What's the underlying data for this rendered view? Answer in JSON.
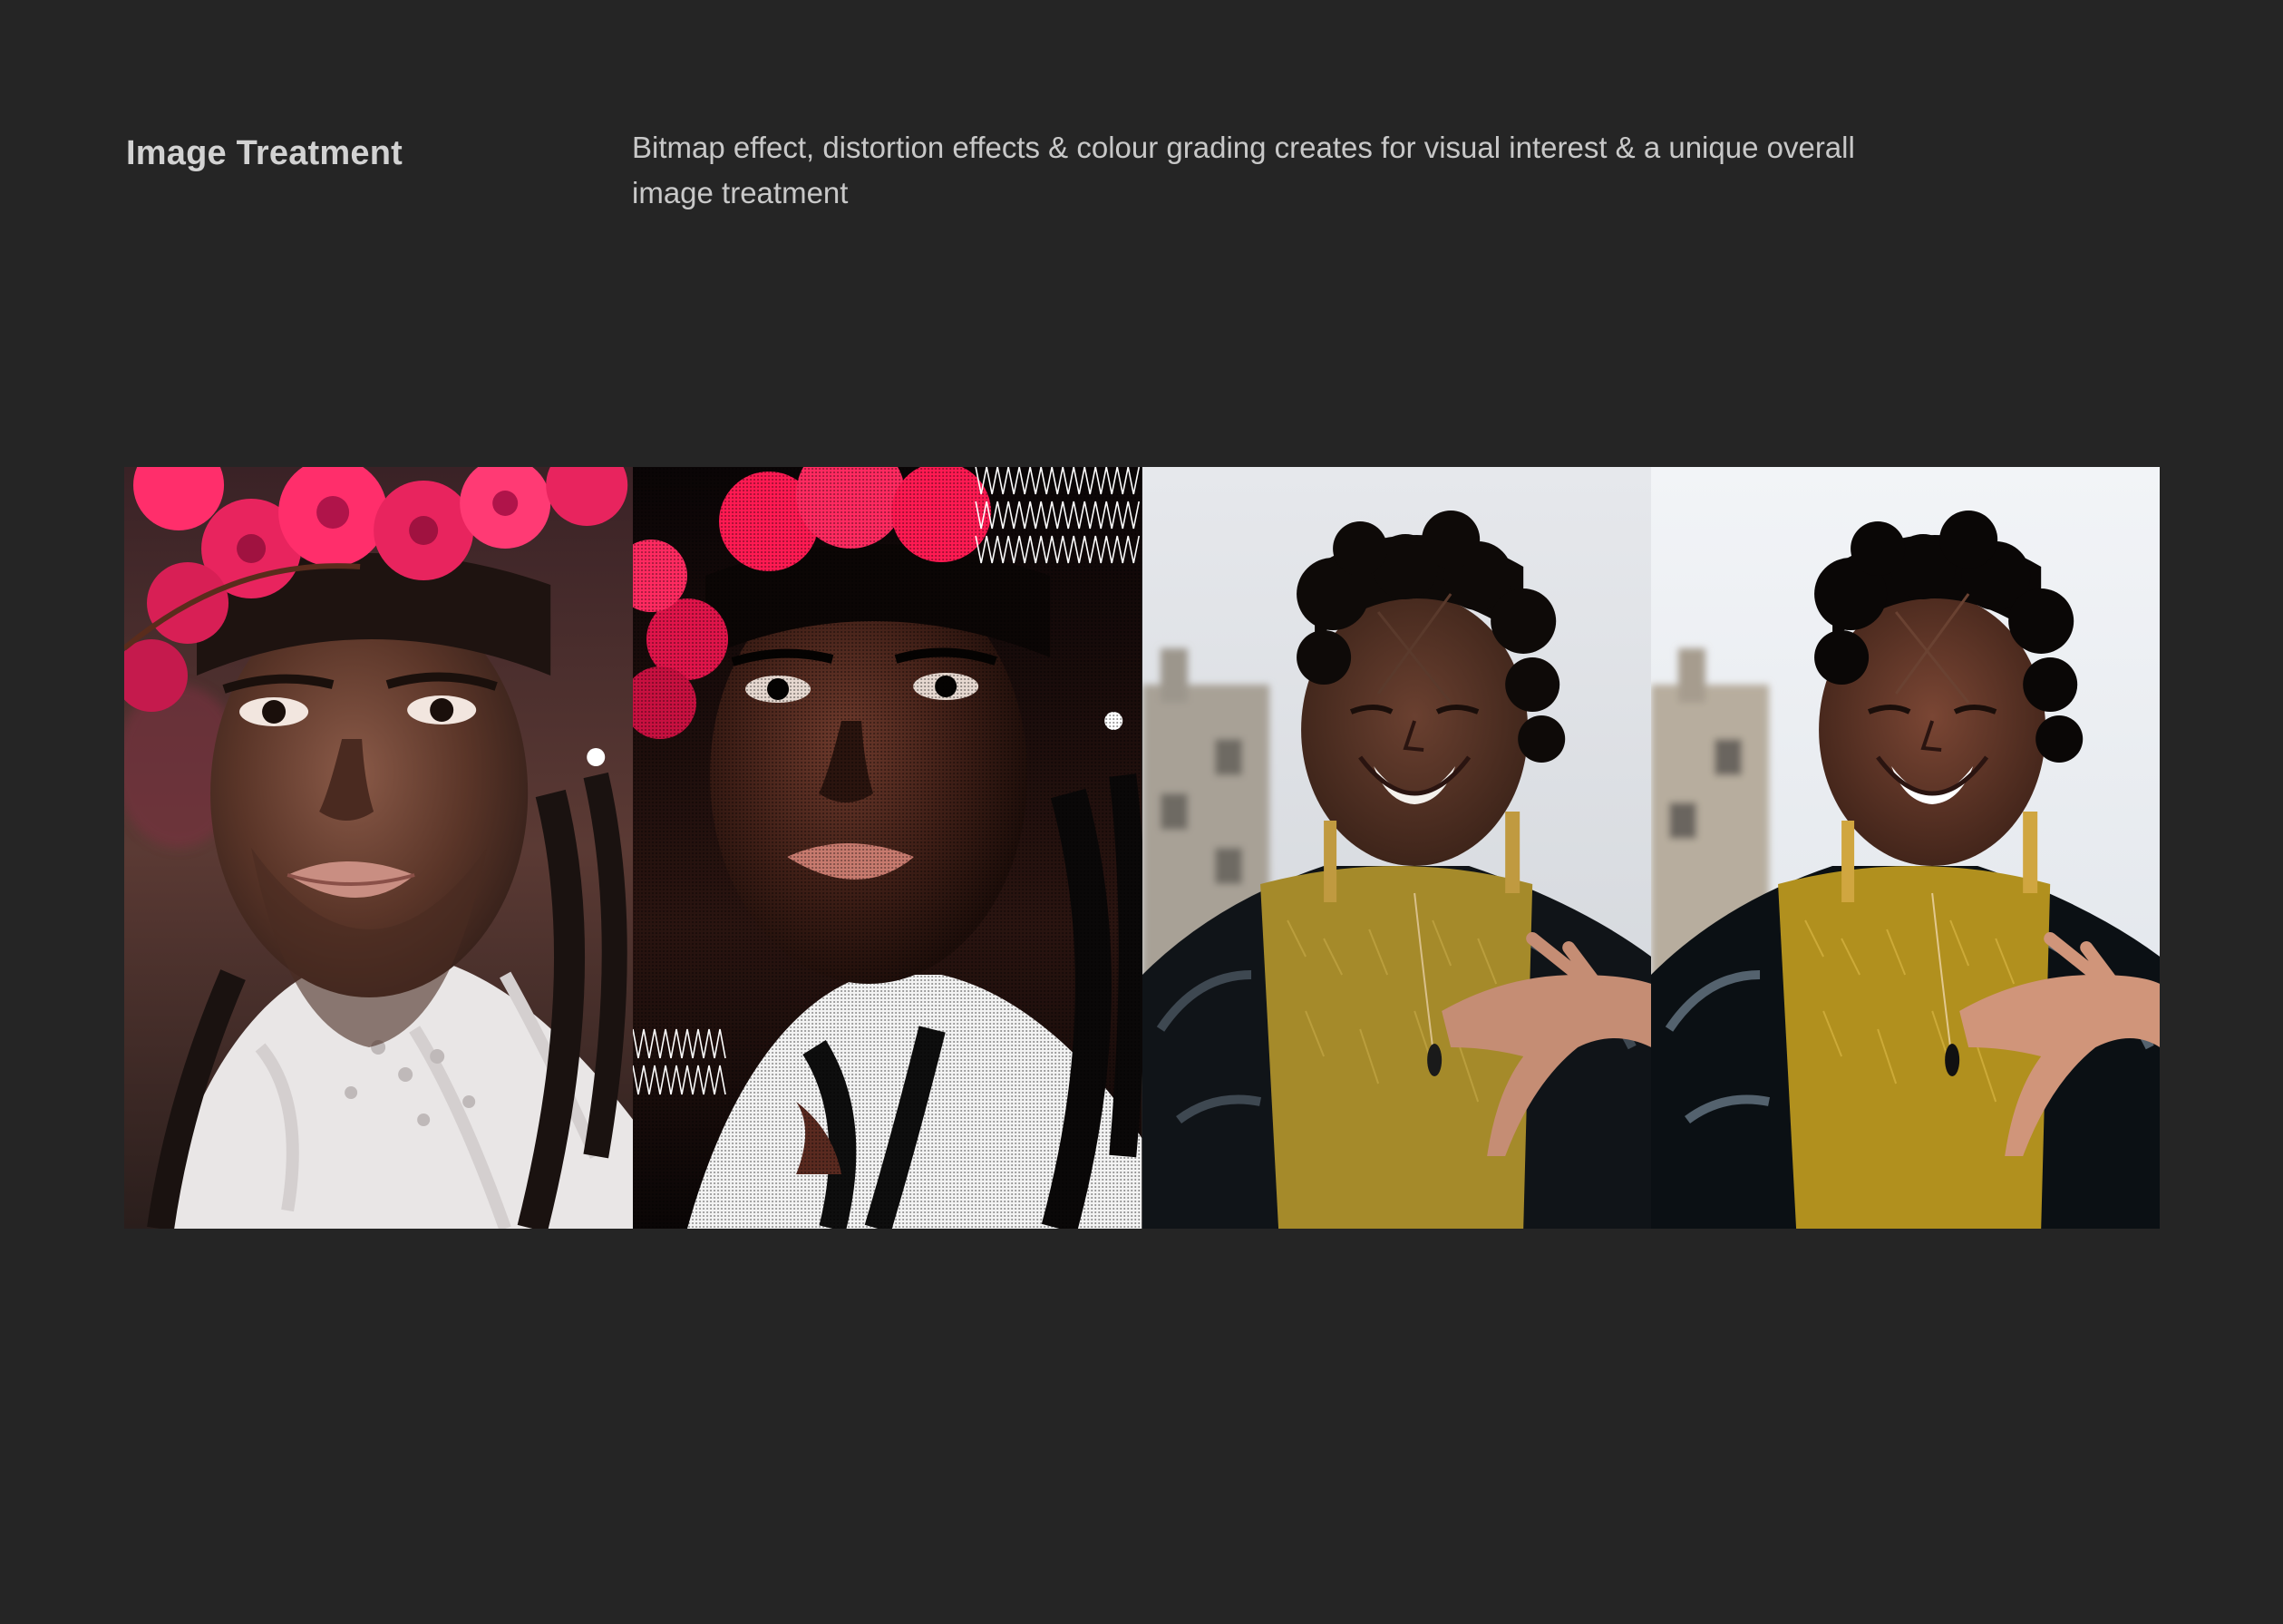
{
  "header": {
    "title": "Image Treatment",
    "description": "Bitmap effect, distortion effects & colour grading creates for visual interest & a unique overall image treatment"
  },
  "gallery": {
    "panels": [
      {
        "id": "portrait-original",
        "treatment": "none"
      },
      {
        "id": "portrait-bitmap",
        "treatment": "bitmap-halftone-with-wave-pattern"
      },
      {
        "id": "laughing-original",
        "treatment": "none"
      },
      {
        "id": "laughing-graded",
        "treatment": "colour-grading"
      }
    ]
  },
  "colors": {
    "background": "#252525",
    "title": "#d2d2d2",
    "description": "#c8c8c8",
    "flower_pink": "#ff2e6b",
    "sweater_mustard": "#a58a2a",
    "jacket_black": "#101418"
  }
}
